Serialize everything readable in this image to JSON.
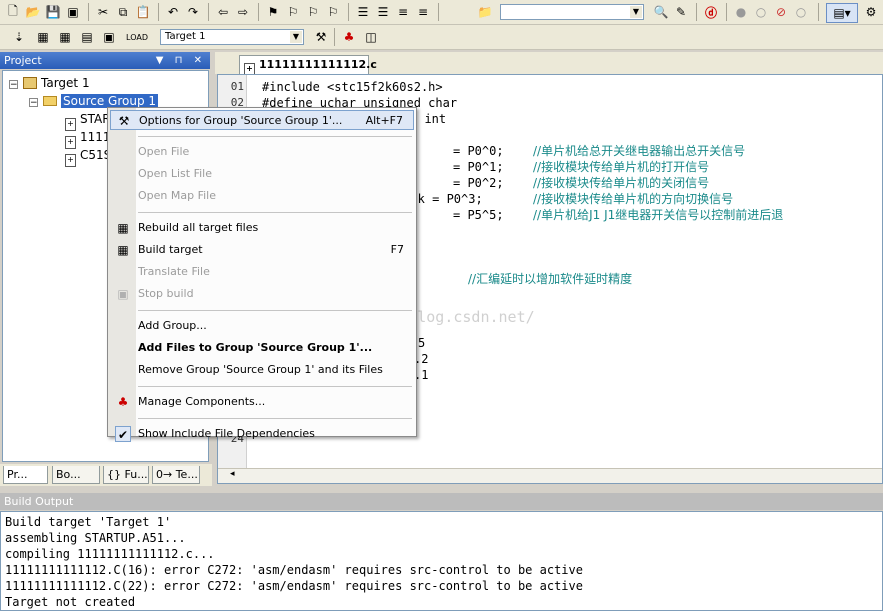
{
  "toolbar": {
    "target_select": "Target 1",
    "search_combo": ""
  },
  "project_panel": {
    "title": "Project",
    "controls": "▼ ⊓ ✕",
    "tree": {
      "target": "Target 1",
      "group": "Source Group 1",
      "files": [
        "STAR",
        "1111",
        "C51S"
      ]
    },
    "tabs": [
      "Pr...",
      "Bo...",
      "{} Fu...",
      "0→ Te..."
    ]
  },
  "editor": {
    "tab_label": "11111111111112.c",
    "lines": [
      {
        "n": "01",
        "code": "#include <stc15f2k60s2.h>",
        "comment": ""
      },
      {
        "n": "02",
        "code": "#define uchar unsigned char",
        "comment": ""
      },
      {
        "n": "",
        "code": "d int",
        "comment": ""
      },
      {
        "n": "",
        "code": "",
        "comment": ""
      },
      {
        "n": "",
        "code": "= P0^0;",
        "comment": "//单片机给总开关继电器输出总开关信号"
      },
      {
        "n": "",
        "code": "= P0^1;",
        "comment": "//接收模块传给单片机的打开信号"
      },
      {
        "n": "",
        "code": "= P0^2;",
        "comment": "//接收模块传给单片机的关闭信号"
      },
      {
        "n": "",
        "code": "back = P0^3;",
        "comment": "//接收模块传给单片机的方向切换信号"
      },
      {
        "n": "",
        "code": "= P5^5;",
        "comment": "//单片机给J1 J1继电器开关信号以控制前进后退"
      },
      {
        "n": "",
        "code": "",
        "comment": ""
      },
      {
        "n": "",
        "code": "",
        "comment": ""
      },
      {
        "n": "",
        "code": "",
        "comment": ""
      },
      {
        "n": "",
        "code": "",
        "comment": "//汇编延时以增加软件延时精度"
      },
      {
        "n": "",
        "code": "",
        "comment": ""
      },
      {
        "n": "",
        "code": "",
        "comment": ""
      },
      {
        "n": "",
        "code": "",
        "comment": ""
      },
      {
        "n": "",
        "code": "5",
        "comment": ""
      },
      {
        "n": "",
        "code": ".2",
        "comment": ""
      },
      {
        "n": "",
        "code": ".1",
        "comment": ""
      },
      {
        "n": "",
        "code": "",
        "comment": ""
      },
      {
        "n": "",
        "code": "",
        "comment": ""
      },
      {
        "n": "",
        "code": "}",
        "comment": ""
      },
      {
        "n": "24",
        "code": "",
        "comment": ""
      }
    ]
  },
  "context_menu": {
    "items": [
      {
        "label": "Options for Group 'Source Group 1'...",
        "shortcut": "Alt+F7",
        "icon": "wand-icon",
        "state": "highlight"
      },
      {
        "sep": true
      },
      {
        "label": "Open File",
        "shortcut": "",
        "state": "disabled"
      },
      {
        "label": "Open List File",
        "shortcut": "",
        "state": "disabled"
      },
      {
        "label": "Open Map File",
        "shortcut": "",
        "state": "disabled"
      },
      {
        "sep": true
      },
      {
        "label": "Rebuild all target files",
        "shortcut": "",
        "icon": "rebuild-icon",
        "state": "normal"
      },
      {
        "label": "Build target",
        "shortcut": "F7",
        "icon": "build-icon",
        "state": "normal"
      },
      {
        "label": "Translate File",
        "shortcut": "",
        "state": "disabled"
      },
      {
        "label": "Stop build",
        "shortcut": "",
        "icon": "stop-build-icon",
        "state": "disabled"
      },
      {
        "sep": true
      },
      {
        "label": "Add Group...",
        "shortcut": "",
        "state": "normal"
      },
      {
        "label": "Add Files to Group 'Source Group 1'...",
        "shortcut": "",
        "state": "bold"
      },
      {
        "label": "Remove Group 'Source Group 1' and its Files",
        "shortcut": "",
        "state": "normal"
      },
      {
        "sep": true
      },
      {
        "label": "Manage Components...",
        "shortcut": "",
        "icon": "components-icon",
        "state": "normal"
      },
      {
        "sep": true
      },
      {
        "label": "Show Include File Dependencies",
        "shortcut": "",
        "icon": "checkmark-icon",
        "state": "normal"
      }
    ]
  },
  "build_output": {
    "title": "Build Output",
    "lines": [
      "Build target 'Target 1'",
      "assembling STARTUP.A51...",
      "compiling 11111111111112.c...",
      "11111111111112.C(16): error C272: 'asm/endasm' requires src-control to be active",
      "11111111111112.C(22): error C272: 'asm/endasm' requires src-control to be active",
      "Target not created"
    ]
  },
  "watermark": "http://blog.csdn.net/"
}
